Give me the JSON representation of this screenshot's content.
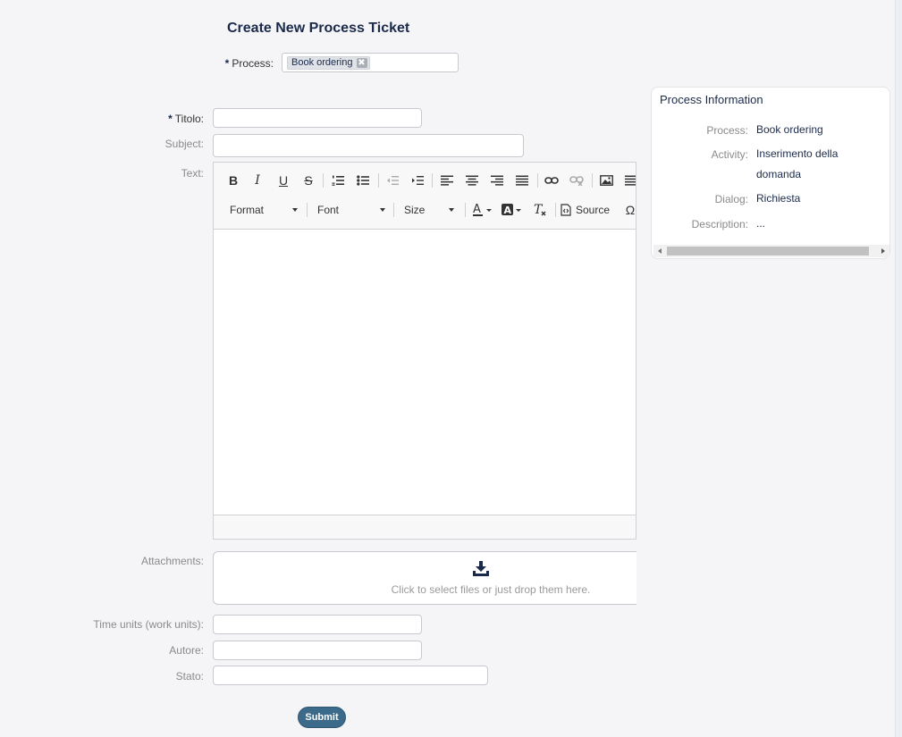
{
  "page": {
    "title": "Create New Process Ticket"
  },
  "form": {
    "required_marker": "*",
    "process_label": "Process:",
    "process_tag": "Book ordering",
    "process_tag_remove": "✖",
    "titolo_label": "Titolo:",
    "titolo_value": "",
    "subject_label": "Subject:",
    "subject_value": "",
    "text_label": "Text:",
    "attachments_label": "Attachments:",
    "attachments_hint": "Click to select files or just drop them here.",
    "time_units_label": "Time units (work units):",
    "time_units_value": "",
    "autore_label": "Autore:",
    "autore_value": "",
    "stato_label": "Stato:",
    "stato_value": "",
    "submit_label": "Submit"
  },
  "editor": {
    "buttons": {
      "bold": "B",
      "italic": "I",
      "underline": "U",
      "strike": "S",
      "source": "Source",
      "special_char": "Ω"
    },
    "format_label": "Format",
    "font_label": "Font",
    "size_label": "Size"
  },
  "info_panel": {
    "title": "Process Information",
    "rows": [
      {
        "key": "Process:",
        "value": "Book ordering"
      },
      {
        "key": "Activity:",
        "value": "Inserimento della domanda"
      },
      {
        "key": "Dialog:",
        "value": "Richiesta"
      },
      {
        "key": "Description:",
        "value": "..."
      }
    ]
  },
  "colors": {
    "accent": "#3c6a8a",
    "title": "#1b2a4a",
    "background": "#f5f5f7"
  }
}
